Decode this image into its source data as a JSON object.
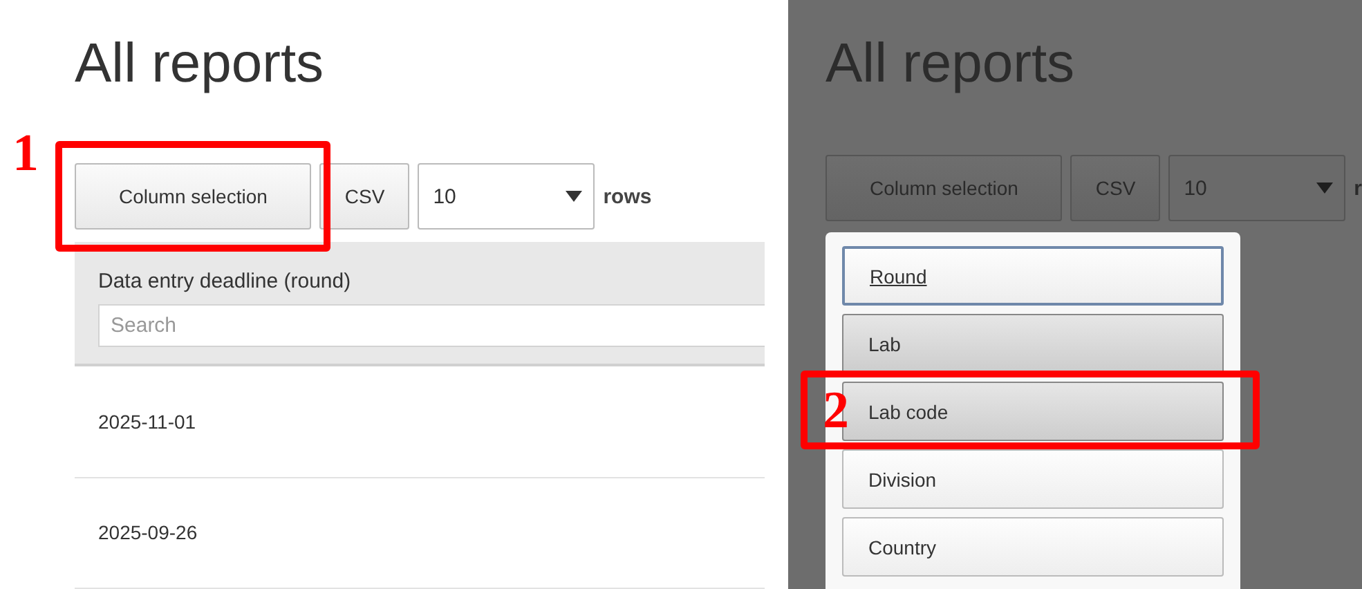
{
  "left_panel": {
    "title": "All reports",
    "toolbar": {
      "column_button": "Column selection",
      "csv_button": "CSV",
      "rows_select": "10",
      "rows_label": "rows"
    },
    "table": {
      "column": "Data entry deadline (round)",
      "search": {
        "placeholder": "Search"
      },
      "rows": [
        "2025-11-01",
        "2025-09-26"
      ]
    },
    "callout": {
      "number": "1"
    }
  },
  "right_panel": {
    "title": "All reports",
    "toolbar": {
      "column_button": "Column selection",
      "csv_button": "CSV",
      "rows_select": "10",
      "rows_label": "r"
    },
    "menu": [
      {
        "label": "Round",
        "focused": true,
        "active": false
      },
      {
        "label": "Lab",
        "focused": false,
        "active": true
      },
      {
        "label": "Lab code",
        "focused": false,
        "active": true
      },
      {
        "label": "Division",
        "focused": false,
        "active": false
      },
      {
        "label": "Country",
        "focused": false,
        "active": false
      }
    ],
    "callout": {
      "number": "2"
    }
  }
}
